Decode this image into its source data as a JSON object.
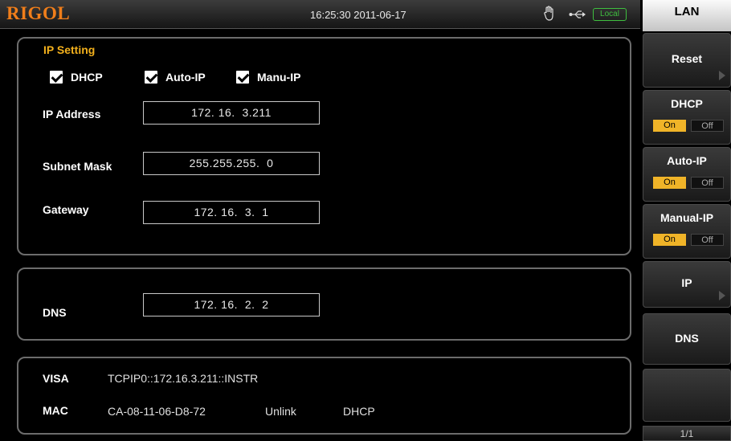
{
  "header": {
    "logo": "RIGOL",
    "datetime": "16:25:30 2011-06-17",
    "status_badge": "Local",
    "icons": [
      "hand-icon",
      "usb-icon"
    ],
    "accent_color": "#f07e1a",
    "badge_color": "#3fbf3f"
  },
  "ip_setting": {
    "title": "IP Setting",
    "checkboxes": [
      {
        "label": "DHCP",
        "checked": true
      },
      {
        "label": "Auto-IP",
        "checked": true
      },
      {
        "label": "Manu-IP",
        "checked": true
      }
    ],
    "fields": [
      {
        "label": "IP Address",
        "value": "172. 16.  3.211"
      },
      {
        "label": "Subnet Mask",
        "value": "255.255.255.  0"
      },
      {
        "label": "Gateway",
        "value": "172. 16.  3.  1"
      }
    ]
  },
  "dns": {
    "label": "DNS",
    "value": "172. 16.  2.  2"
  },
  "info": {
    "visa_label": "VISA",
    "visa_value": "TCPIP0::172.16.3.211::INSTR",
    "mac_label": "MAC",
    "mac_value": "CA-08-11-06-D8-72",
    "link_status": "Unlink",
    "mode": "DHCP"
  },
  "softkeys": {
    "menu_title": "LAN",
    "reset": "Reset",
    "dhcp": {
      "label": "DHCP",
      "on": "On",
      "off": "Off",
      "state": "On"
    },
    "autoip": {
      "label": "Auto-IP",
      "on": "On",
      "off": "Off",
      "state": "On"
    },
    "manualip": {
      "label": "Manual-IP",
      "on": "On",
      "off": "Off",
      "state": "On"
    },
    "ip": "IP",
    "dns": "DNS",
    "blank": "",
    "page": "1/1",
    "on_color": "#f0b428"
  }
}
